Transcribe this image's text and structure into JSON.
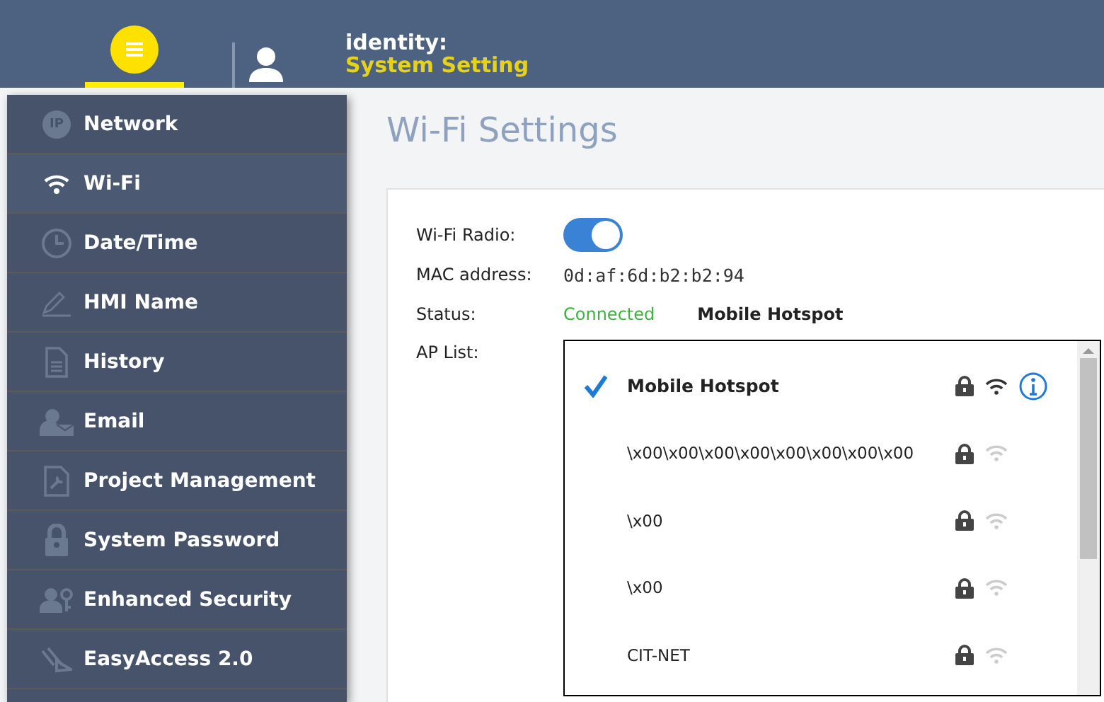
{
  "header": {
    "identity_label": "identity:",
    "identity_value": "System Setting"
  },
  "sidebar": {
    "items": [
      {
        "label": "Network",
        "kind": "ip",
        "icon_text": "IP",
        "selected": false
      },
      {
        "label": "Wi-Fi",
        "kind": "wifi",
        "selected": true
      },
      {
        "label": "Date/Time",
        "kind": "clock",
        "selected": false
      },
      {
        "label": "HMI Name",
        "kind": "pencil",
        "selected": false
      },
      {
        "label": "History",
        "kind": "document",
        "selected": false
      },
      {
        "label": "Email",
        "kind": "email",
        "selected": false
      },
      {
        "label": "Project Management",
        "kind": "project",
        "selected": false
      },
      {
        "label": "System Password",
        "kind": "lock",
        "selected": false
      },
      {
        "label": "Enhanced Security",
        "kind": "users",
        "selected": false
      },
      {
        "label": "EasyAccess 2.0",
        "kind": "easyaccess",
        "selected": false
      }
    ]
  },
  "page": {
    "title": "Wi-Fi Settings",
    "wifi_radio": {
      "label": "Wi-Fi Radio:",
      "on": true
    },
    "mac": {
      "label": "MAC address:",
      "value": "0d:af:6d:b2:b2:94"
    },
    "status": {
      "label": "Status:",
      "state": "Connected",
      "network": "Mobile Hotspot"
    },
    "ap_list": {
      "label": "AP List:",
      "items": [
        {
          "name": "Mobile Hotspot",
          "selected": true,
          "locked": true
        },
        {
          "name": "\\x00\\x00\\x00\\x00\\x00\\x00\\x00\\x00",
          "selected": false,
          "locked": true
        },
        {
          "name": "\\x00",
          "selected": false,
          "locked": true
        },
        {
          "name": "\\x00",
          "selected": false,
          "locked": true
        },
        {
          "name": "CIT-NET",
          "selected": false,
          "locked": true
        }
      ]
    }
  }
}
